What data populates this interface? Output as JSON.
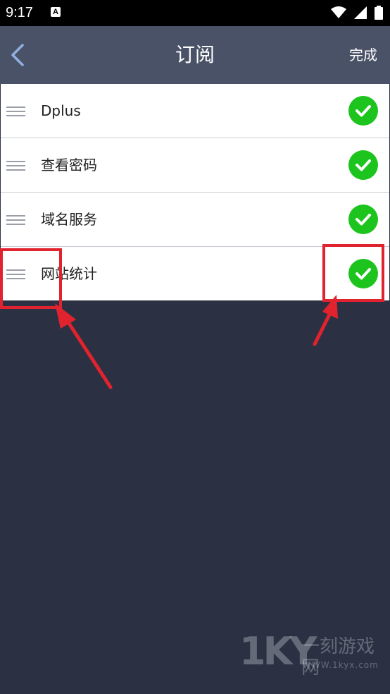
{
  "status_bar": {
    "time": "9:17",
    "notification_icon": "A",
    "icons": [
      "wifi-icon",
      "signal-icon",
      "battery-icon"
    ]
  },
  "app_bar": {
    "title": "订阅",
    "done_label": "完成",
    "back_icon": "chevron-left-icon"
  },
  "subscriptions": [
    {
      "label": "Dplus",
      "checked": true
    },
    {
      "label": "查看密码",
      "checked": true
    },
    {
      "label": "域名服务",
      "checked": true
    },
    {
      "label": "网站统计",
      "checked": true
    }
  ],
  "colors": {
    "app_bar": "#4a5267",
    "background": "#2b3142",
    "check": "#1dc41d",
    "annotation": "#e0232e"
  },
  "watermark": {
    "logo": "1KY",
    "name": "一刻游戏网",
    "url": "WWW.1kyx.com"
  }
}
